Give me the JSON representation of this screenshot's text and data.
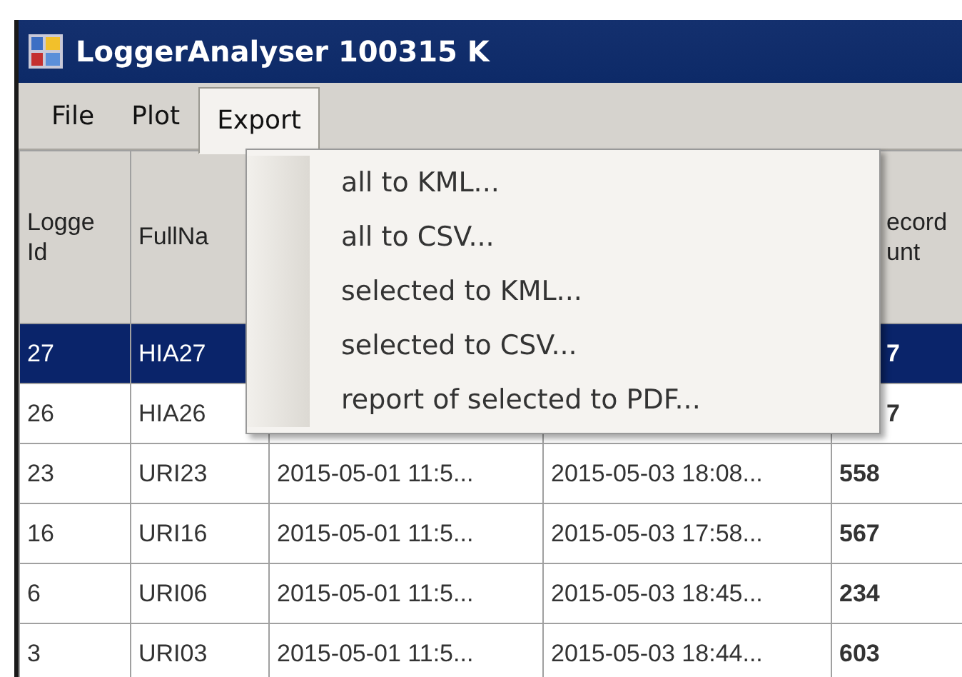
{
  "window": {
    "title": "LoggerAnalyser 100315 K"
  },
  "menu_bar": [
    {
      "label": "File",
      "selected": false
    },
    {
      "label": "Plot",
      "selected": false
    },
    {
      "label": "Export",
      "selected": true
    }
  ],
  "export_menu": [
    "all to KML...",
    "all to CSV...",
    "selected to KML...",
    "selected to CSV...",
    "report of selected to PDF..."
  ],
  "table": {
    "columns": [
      "Logge\nId",
      "FullNa",
      null,
      null,
      "ecord\nunt"
    ],
    "rows": [
      {
        "selected": true,
        "cells": [
          "27",
          "HIA27",
          null,
          null,
          "7"
        ]
      },
      {
        "selected": false,
        "cells": [
          "26",
          "HIA26",
          null,
          null,
          "7"
        ]
      },
      {
        "selected": false,
        "cells": [
          "23",
          "URI23",
          "2015-05-01 11:5...",
          "2015-05-03 18:08...",
          "558"
        ]
      },
      {
        "selected": false,
        "cells": [
          "16",
          "URI16",
          "2015-05-01 11:5...",
          "2015-05-03 17:58...",
          "567"
        ]
      },
      {
        "selected": false,
        "cells": [
          "6",
          "URI06",
          "2015-05-01 11:5...",
          "2015-05-03 18:45...",
          "234"
        ]
      },
      {
        "selected": false,
        "cells": [
          "3",
          "URI03",
          "2015-05-01 11:5...",
          "2015-05-03 18:44...",
          "603"
        ]
      }
    ]
  }
}
